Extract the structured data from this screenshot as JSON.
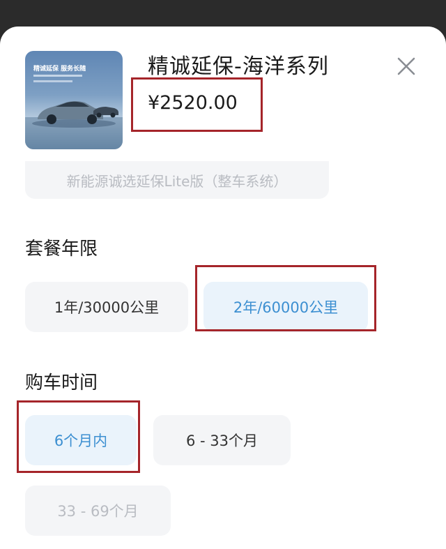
{
  "product": {
    "title": "精诚延保-海洋系列",
    "price": "¥2520.00",
    "thumbnail_slogan": "精诚延保 服务长随",
    "variant_label": "新能源诚选延保Lite版（整车系统）"
  },
  "sections": {
    "years": {
      "title": "套餐年限",
      "options": [
        {
          "label": "1年/30000公里",
          "state": "normal"
        },
        {
          "label": "2年/60000公里",
          "state": "selected"
        }
      ]
    },
    "purchase_time": {
      "title": "购车时间",
      "options": [
        {
          "label": "6个月内",
          "state": "selected"
        },
        {
          "label": "6 -  33个月",
          "state": "normal"
        },
        {
          "label": "33 -  69个月",
          "state": "disabled"
        }
      ]
    }
  },
  "icons": {
    "close": "close-icon",
    "thumbnail": "car-thumbnail"
  },
  "colors": {
    "selected_text": "#3c8fd1",
    "selected_bg": "#eaf3fb",
    "chip_bg": "#f4f5f7",
    "disabled_text": "#b9bcc2",
    "highlight_box": "#a5252a"
  }
}
